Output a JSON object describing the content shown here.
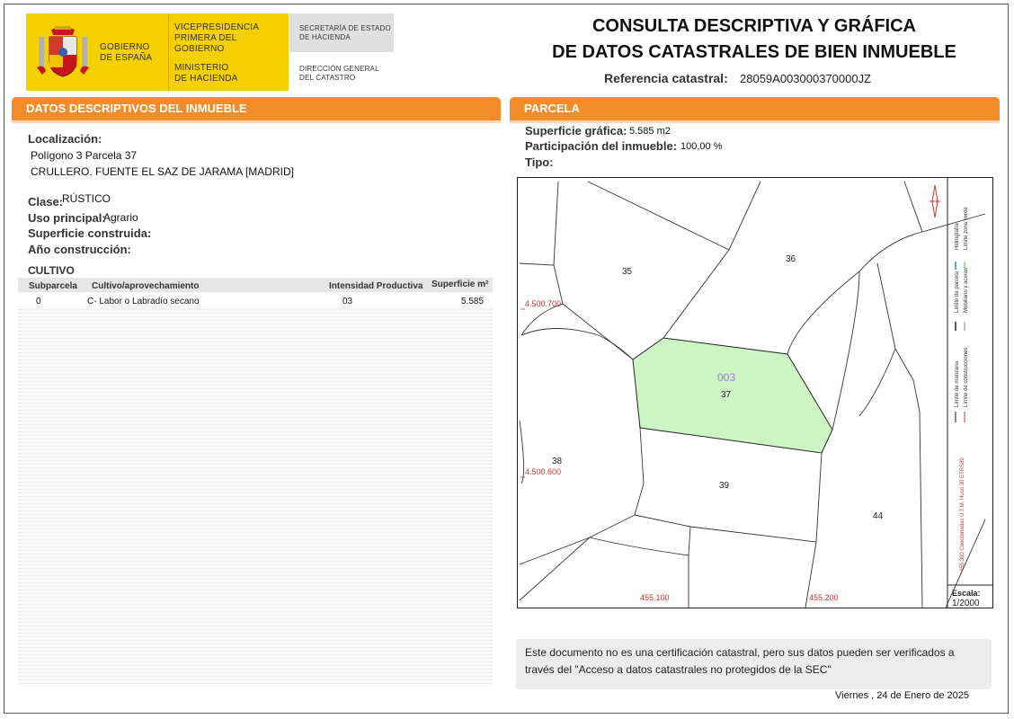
{
  "header": {
    "gobierno": [
      "GOBIERNO",
      "DE ESPAÑA"
    ],
    "vicepresidencia": [
      "VICEPRESIDENCIA",
      "PRIMERA DEL GOBIERNO"
    ],
    "ministerio": [
      "MINISTERIO",
      "DE HACIENDA"
    ],
    "secretaria": [
      "SECRETARÍA DE ESTADO",
      "DE HACIENDA"
    ],
    "direccion": [
      "DIRECCIÓN GENERAL",
      "DEL CATASTRO"
    ],
    "title_line1": "CONSULTA DESCRIPTIVA Y GRÁFICA",
    "title_line2": "DE DATOS CATASTRALES DE BIEN INMUEBLE",
    "ref_label": "Referencia catastral:",
    "ref_value": "28059A003000370000JZ",
    "brand_color": "#f5d000",
    "accent_color": "#f28c28"
  },
  "left": {
    "section_title": "DATOS DESCRIPTIVOS DEL INMUEBLE",
    "localizacion_label": "Localización:",
    "localizacion_line1": "Polígono 3 Parcela 37",
    "localizacion_line2": "CRULLERO. FUENTE EL SAZ DE JARAMA [MADRID]",
    "clase_label": "Clase:",
    "clase_value": "RÚSTICO",
    "uso_label": "Uso principal:",
    "uso_value": "Agrario",
    "superficie_label": "Superficie construida:",
    "anio_label": "Año construcción:",
    "cultivo_label": "CULTIVO",
    "table": {
      "headers": [
        "Subparcela",
        "Cultivo/aprovechamiento",
        "Intensidad Productiva",
        "Superficie m²"
      ],
      "rows": [
        [
          "0",
          "C- Labor o Labradío secano",
          "03",
          "5.585"
        ]
      ]
    }
  },
  "right": {
    "section_title": "PARCELA",
    "superficie_label": "Superficie gráfica:",
    "superficie_value": "5.585 m2",
    "participacion_label": "Participación del inmueble:",
    "participacion_value": "100,00 %",
    "tipo_label": "Tipo:",
    "map": {
      "highlight_color": "#ccf5c3",
      "subparcel_label": "003",
      "parcel_labels": [
        "35",
        "36",
        "37",
        "38",
        "39",
        "44"
      ],
      "coord_y_top": "4.500.700",
      "coord_y_bottom": "4.500.600",
      "coord_x_left": "455.100",
      "coord_x_right": "455.200",
      "legend": {
        "hidrografia": "Hidrografía",
        "limite_zona_verde": "Límite zona verde",
        "limite_parcela": "Límite de parcela",
        "mobiliario": "Mobiliario y aceras",
        "limite_manzana": "Límite de manzana",
        "limite_construcciones": "Límite de construcciones",
        "coordenadas": "455,300 Coordenadas U.T.M. Huso 30 ETRS89"
      },
      "escala_label": "Escala:",
      "escala_value": "1/2000"
    },
    "note": "Este documento no es una certificación catastral, pero sus datos pueden ser verificados a través del \"Acceso a datos catastrales no protegidos de la SEC\"",
    "date": "Viernes , 24 de Enero de 2025"
  }
}
